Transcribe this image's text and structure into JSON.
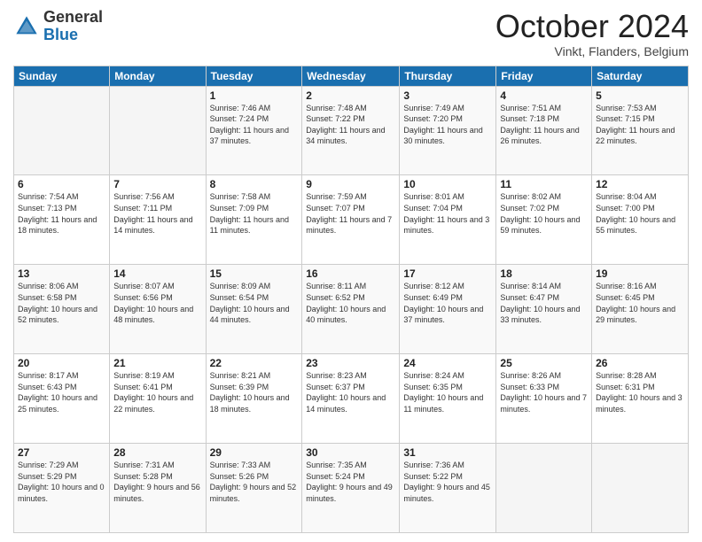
{
  "header": {
    "logo": {
      "line1": "General",
      "line2": "Blue"
    },
    "title": "October 2024",
    "subtitle": "Vinkt, Flanders, Belgium"
  },
  "days_of_week": [
    "Sunday",
    "Monday",
    "Tuesday",
    "Wednesday",
    "Thursday",
    "Friday",
    "Saturday"
  ],
  "weeks": [
    [
      {
        "day": "",
        "sunrise": "",
        "sunset": "",
        "daylight": ""
      },
      {
        "day": "",
        "sunrise": "",
        "sunset": "",
        "daylight": ""
      },
      {
        "day": "1",
        "sunrise": "Sunrise: 7:46 AM",
        "sunset": "Sunset: 7:24 PM",
        "daylight": "Daylight: 11 hours and 37 minutes."
      },
      {
        "day": "2",
        "sunrise": "Sunrise: 7:48 AM",
        "sunset": "Sunset: 7:22 PM",
        "daylight": "Daylight: 11 hours and 34 minutes."
      },
      {
        "day": "3",
        "sunrise": "Sunrise: 7:49 AM",
        "sunset": "Sunset: 7:20 PM",
        "daylight": "Daylight: 11 hours and 30 minutes."
      },
      {
        "day": "4",
        "sunrise": "Sunrise: 7:51 AM",
        "sunset": "Sunset: 7:18 PM",
        "daylight": "Daylight: 11 hours and 26 minutes."
      },
      {
        "day": "5",
        "sunrise": "Sunrise: 7:53 AM",
        "sunset": "Sunset: 7:15 PM",
        "daylight": "Daylight: 11 hours and 22 minutes."
      }
    ],
    [
      {
        "day": "6",
        "sunrise": "Sunrise: 7:54 AM",
        "sunset": "Sunset: 7:13 PM",
        "daylight": "Daylight: 11 hours and 18 minutes."
      },
      {
        "day": "7",
        "sunrise": "Sunrise: 7:56 AM",
        "sunset": "Sunset: 7:11 PM",
        "daylight": "Daylight: 11 hours and 14 minutes."
      },
      {
        "day": "8",
        "sunrise": "Sunrise: 7:58 AM",
        "sunset": "Sunset: 7:09 PM",
        "daylight": "Daylight: 11 hours and 11 minutes."
      },
      {
        "day": "9",
        "sunrise": "Sunrise: 7:59 AM",
        "sunset": "Sunset: 7:07 PM",
        "daylight": "Daylight: 11 hours and 7 minutes."
      },
      {
        "day": "10",
        "sunrise": "Sunrise: 8:01 AM",
        "sunset": "Sunset: 7:04 PM",
        "daylight": "Daylight: 11 hours and 3 minutes."
      },
      {
        "day": "11",
        "sunrise": "Sunrise: 8:02 AM",
        "sunset": "Sunset: 7:02 PM",
        "daylight": "Daylight: 10 hours and 59 minutes."
      },
      {
        "day": "12",
        "sunrise": "Sunrise: 8:04 AM",
        "sunset": "Sunset: 7:00 PM",
        "daylight": "Daylight: 10 hours and 55 minutes."
      }
    ],
    [
      {
        "day": "13",
        "sunrise": "Sunrise: 8:06 AM",
        "sunset": "Sunset: 6:58 PM",
        "daylight": "Daylight: 10 hours and 52 minutes."
      },
      {
        "day": "14",
        "sunrise": "Sunrise: 8:07 AM",
        "sunset": "Sunset: 6:56 PM",
        "daylight": "Daylight: 10 hours and 48 minutes."
      },
      {
        "day": "15",
        "sunrise": "Sunrise: 8:09 AM",
        "sunset": "Sunset: 6:54 PM",
        "daylight": "Daylight: 10 hours and 44 minutes."
      },
      {
        "day": "16",
        "sunrise": "Sunrise: 8:11 AM",
        "sunset": "Sunset: 6:52 PM",
        "daylight": "Daylight: 10 hours and 40 minutes."
      },
      {
        "day": "17",
        "sunrise": "Sunrise: 8:12 AM",
        "sunset": "Sunset: 6:49 PM",
        "daylight": "Daylight: 10 hours and 37 minutes."
      },
      {
        "day": "18",
        "sunrise": "Sunrise: 8:14 AM",
        "sunset": "Sunset: 6:47 PM",
        "daylight": "Daylight: 10 hours and 33 minutes."
      },
      {
        "day": "19",
        "sunrise": "Sunrise: 8:16 AM",
        "sunset": "Sunset: 6:45 PM",
        "daylight": "Daylight: 10 hours and 29 minutes."
      }
    ],
    [
      {
        "day": "20",
        "sunrise": "Sunrise: 8:17 AM",
        "sunset": "Sunset: 6:43 PM",
        "daylight": "Daylight: 10 hours and 25 minutes."
      },
      {
        "day": "21",
        "sunrise": "Sunrise: 8:19 AM",
        "sunset": "Sunset: 6:41 PM",
        "daylight": "Daylight: 10 hours and 22 minutes."
      },
      {
        "day": "22",
        "sunrise": "Sunrise: 8:21 AM",
        "sunset": "Sunset: 6:39 PM",
        "daylight": "Daylight: 10 hours and 18 minutes."
      },
      {
        "day": "23",
        "sunrise": "Sunrise: 8:23 AM",
        "sunset": "Sunset: 6:37 PM",
        "daylight": "Daylight: 10 hours and 14 minutes."
      },
      {
        "day": "24",
        "sunrise": "Sunrise: 8:24 AM",
        "sunset": "Sunset: 6:35 PM",
        "daylight": "Daylight: 10 hours and 11 minutes."
      },
      {
        "day": "25",
        "sunrise": "Sunrise: 8:26 AM",
        "sunset": "Sunset: 6:33 PM",
        "daylight": "Daylight: 10 hours and 7 minutes."
      },
      {
        "day": "26",
        "sunrise": "Sunrise: 8:28 AM",
        "sunset": "Sunset: 6:31 PM",
        "daylight": "Daylight: 10 hours and 3 minutes."
      }
    ],
    [
      {
        "day": "27",
        "sunrise": "Sunrise: 7:29 AM",
        "sunset": "Sunset: 5:29 PM",
        "daylight": "Daylight: 10 hours and 0 minutes."
      },
      {
        "day": "28",
        "sunrise": "Sunrise: 7:31 AM",
        "sunset": "Sunset: 5:28 PM",
        "daylight": "Daylight: 9 hours and 56 minutes."
      },
      {
        "day": "29",
        "sunrise": "Sunrise: 7:33 AM",
        "sunset": "Sunset: 5:26 PM",
        "daylight": "Daylight: 9 hours and 52 minutes."
      },
      {
        "day": "30",
        "sunrise": "Sunrise: 7:35 AM",
        "sunset": "Sunset: 5:24 PM",
        "daylight": "Daylight: 9 hours and 49 minutes."
      },
      {
        "day": "31",
        "sunrise": "Sunrise: 7:36 AM",
        "sunset": "Sunset: 5:22 PM",
        "daylight": "Daylight: 9 hours and 45 minutes."
      },
      {
        "day": "",
        "sunrise": "",
        "sunset": "",
        "daylight": ""
      },
      {
        "day": "",
        "sunrise": "",
        "sunset": "",
        "daylight": ""
      }
    ]
  ]
}
